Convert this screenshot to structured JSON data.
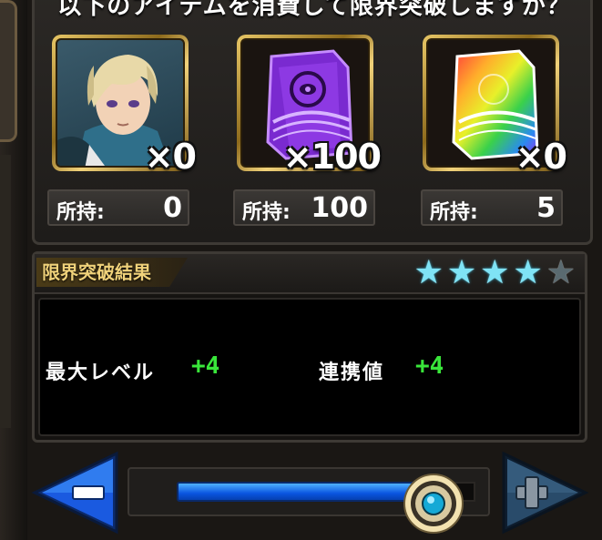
{
  "header": {
    "text": "以下のアイテムを消費して限界突破しますか？"
  },
  "items": [
    {
      "icon": "character-portrait-icon",
      "count_text": "×0",
      "owned_label": "所持:",
      "owned_value": "0"
    },
    {
      "icon": "purple-eye-card-icon",
      "count_text": "×100",
      "owned_label": "所持:",
      "owned_value": "100"
    },
    {
      "icon": "rainbow-card-icon",
      "count_text": "×0",
      "owned_label": "所持:",
      "owned_value": "5"
    }
  ],
  "result": {
    "title": "限界突破結果",
    "stars_total": 5,
    "stars_filled": 4,
    "stats": [
      {
        "label": "最大レベル",
        "value": "+4"
      },
      {
        "label": "連携値",
        "value": "+4"
      }
    ]
  },
  "slider": {
    "fraction": 0.86
  },
  "controls": {
    "minus_icon": "minus-arrow-icon",
    "plus_icon": "plus-arrow-icon"
  },
  "colors": {
    "gold": "#d8b452",
    "star": "#7fe3f5",
    "stat_green": "#39e63a",
    "slider_blue": "#1a6cf0"
  }
}
